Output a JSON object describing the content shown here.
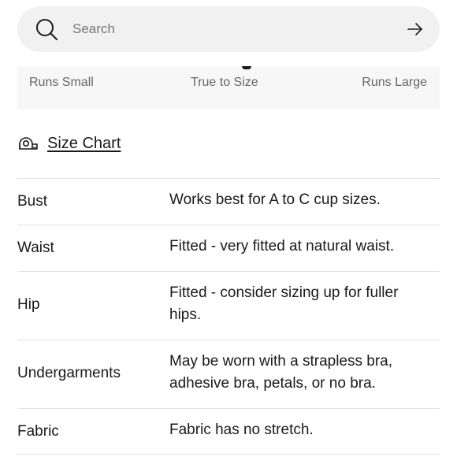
{
  "search": {
    "placeholder": "Search"
  },
  "fit_scale": {
    "min_label": "Runs Small",
    "mid_label": "True to Size",
    "max_label": "Runs Large"
  },
  "size_chart": {
    "label": "Size Chart"
  },
  "fit_details": [
    {
      "label": "Bust",
      "value": "Works best for A to C cup sizes."
    },
    {
      "label": "Waist",
      "value": "Fitted - very fitted at natural waist."
    },
    {
      "label": "Hip",
      "value": "Fitted - consider sizing up for fuller hips."
    },
    {
      "label": "Undergarments",
      "value": "May be worn with a strapless bra, adhesive bra, petals, or no bra."
    },
    {
      "label": "Fabric",
      "value": "Fabric has no stretch."
    }
  ],
  "colors": {
    "search_bg": "#f1f1f1",
    "fit_box_bg": "#f7f7f7",
    "divider": "#e2e2e2",
    "text": "#1a1a1a",
    "muted_text": "#666666"
  },
  "icons": {
    "search": "search-icon",
    "submit": "arrow-right-icon",
    "size_chart": "measuring-tape-icon"
  }
}
